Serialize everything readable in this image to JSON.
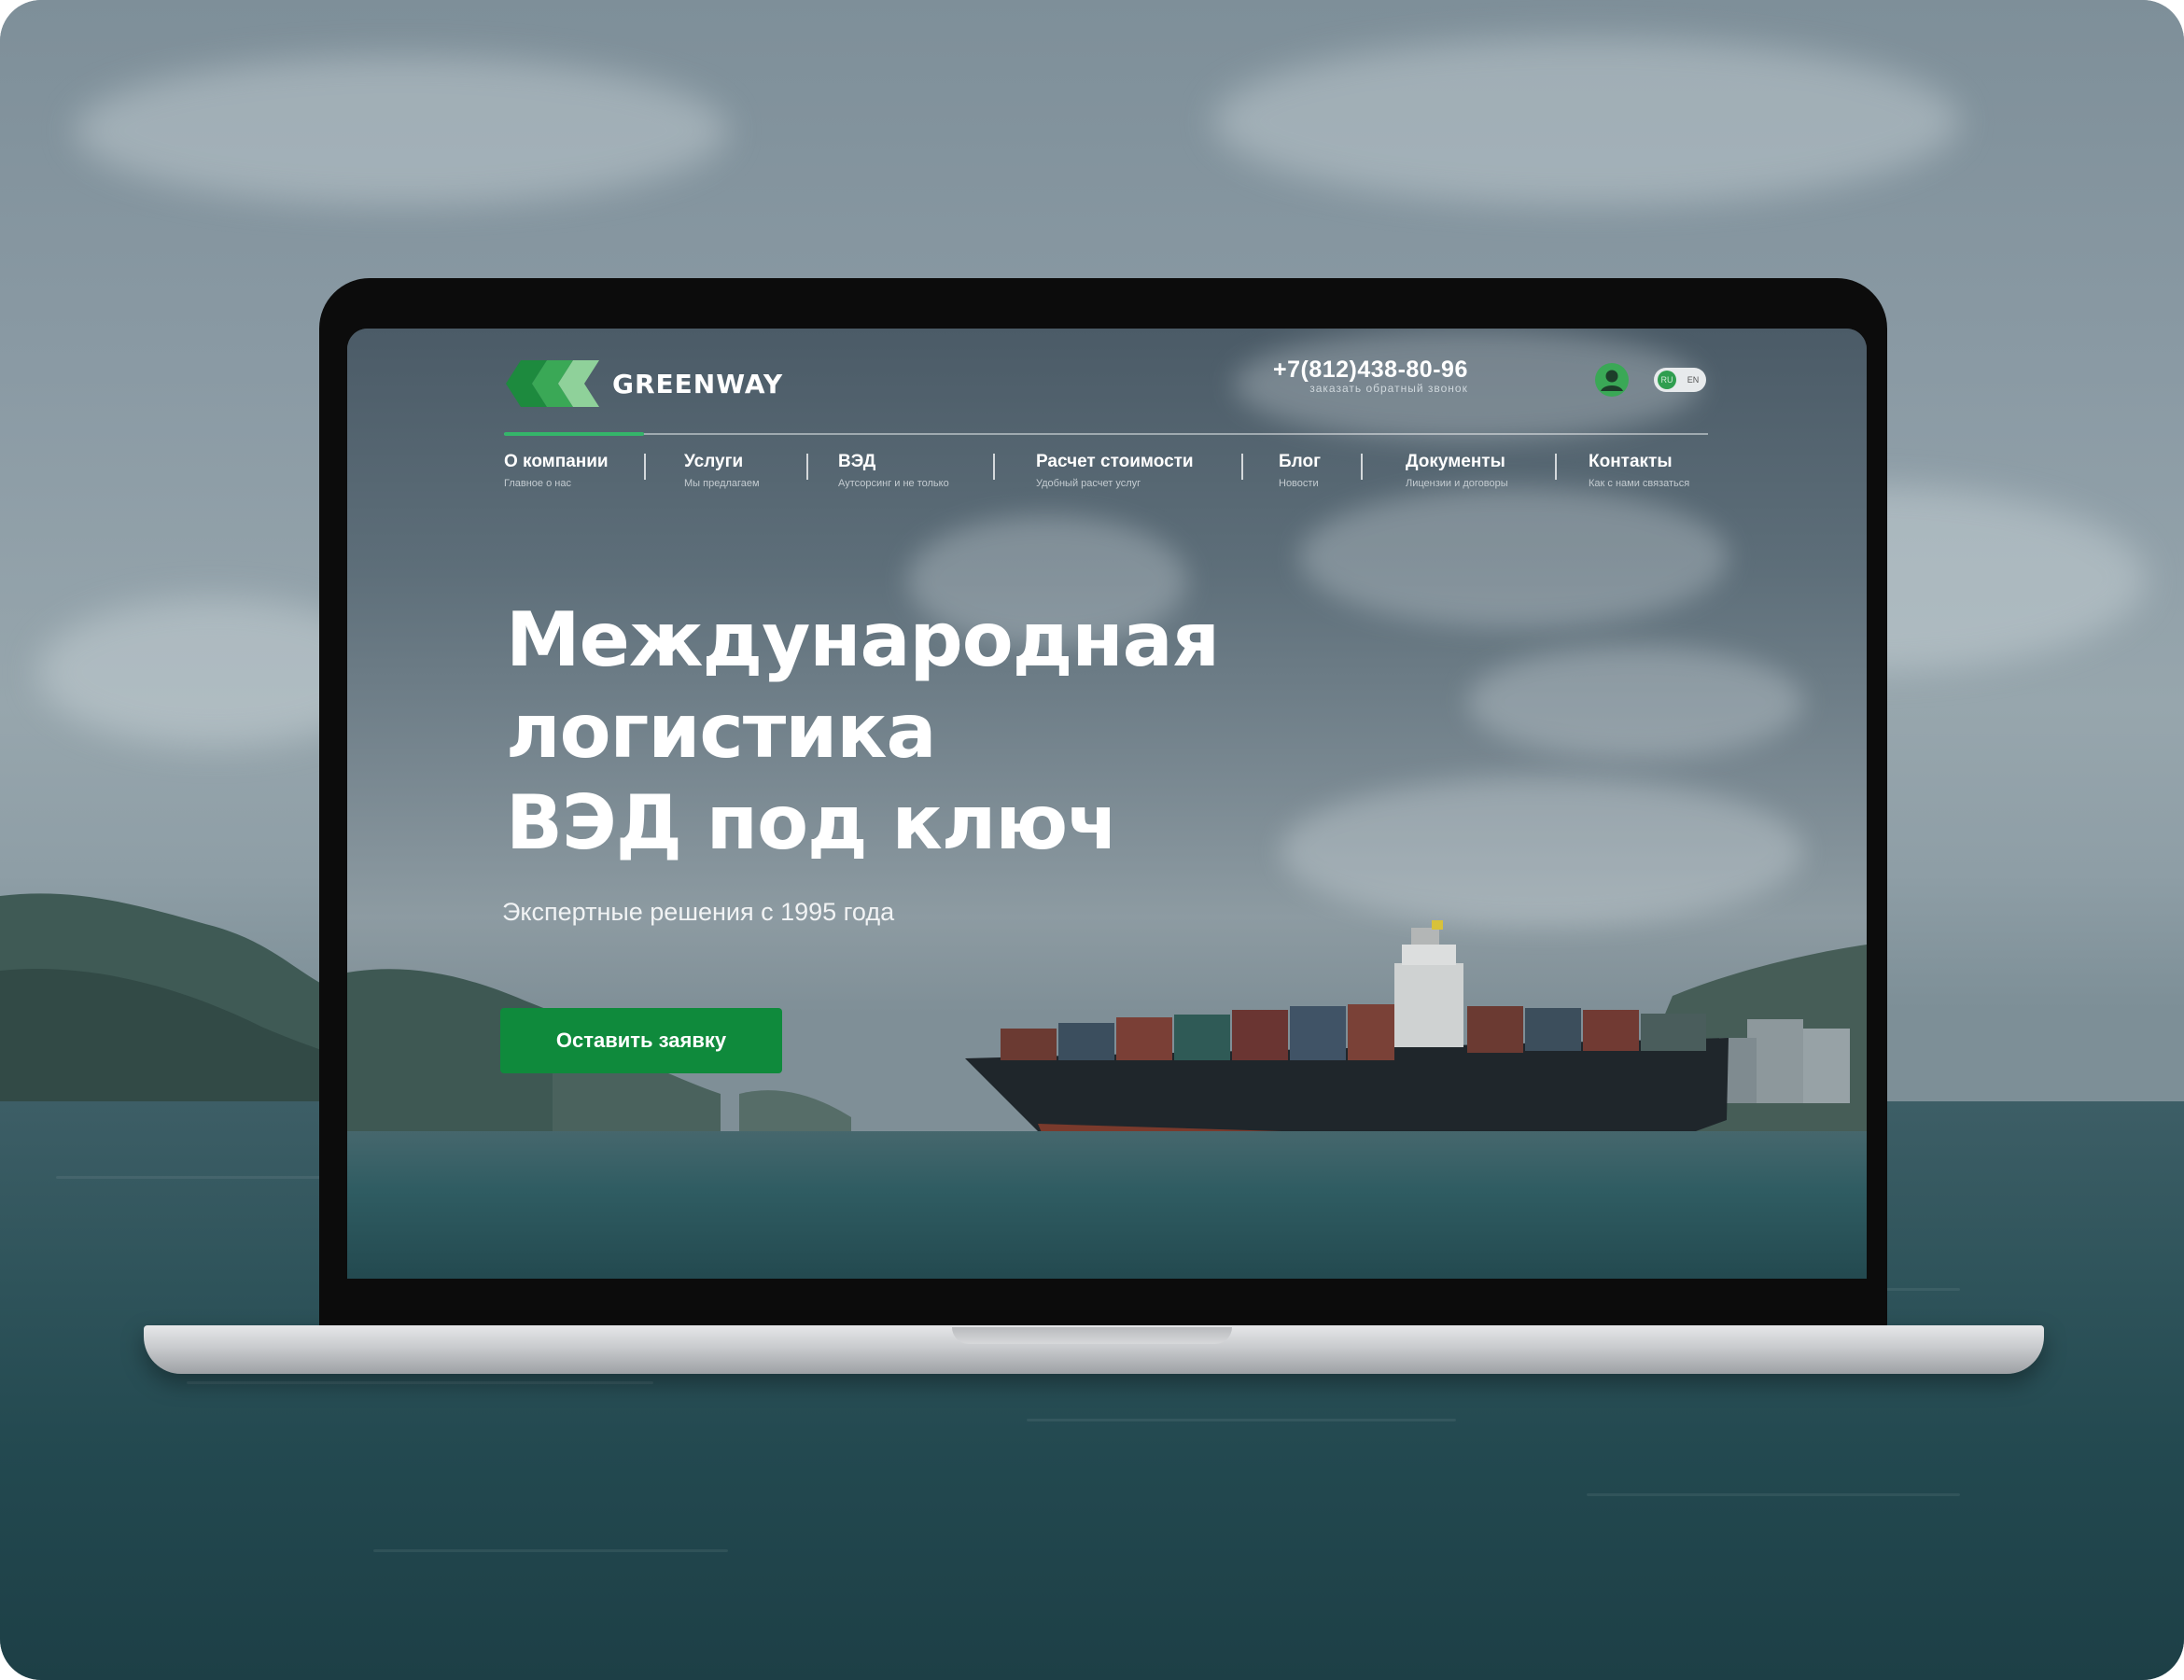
{
  "logo": {
    "name": "GREENWAY"
  },
  "header": {
    "phone": "+7(812)438-80-96",
    "callback": "заказать обратный звонок",
    "lang_ru": "RU",
    "lang_en": "EN"
  },
  "nav": [
    {
      "label": "О компании",
      "sub": "Главное о нас"
    },
    {
      "label": "Услуги",
      "sub": "Мы предлагаем"
    },
    {
      "label": "ВЭД",
      "sub": "Аутсорсинг и не только"
    },
    {
      "label": "Расчет стоимости",
      "sub": "Удобный расчет услуг"
    },
    {
      "label": "Блог",
      "sub": "Новости"
    },
    {
      "label": "Документы",
      "sub": "Лицензии и договоры"
    },
    {
      "label": "Контакты",
      "sub": "Как с нами связаться"
    }
  ],
  "hero": {
    "line1": "Международная",
    "line2": "логистика",
    "line3": "ВЭД под ключ",
    "subtitle": "Экспертные решения с 1995 года",
    "cta": "Оставить заявку"
  },
  "colors": {
    "brand_green": "#0f8a3c",
    "accent_green": "#35b56a",
    "logo_green": "#2f9e4f"
  }
}
